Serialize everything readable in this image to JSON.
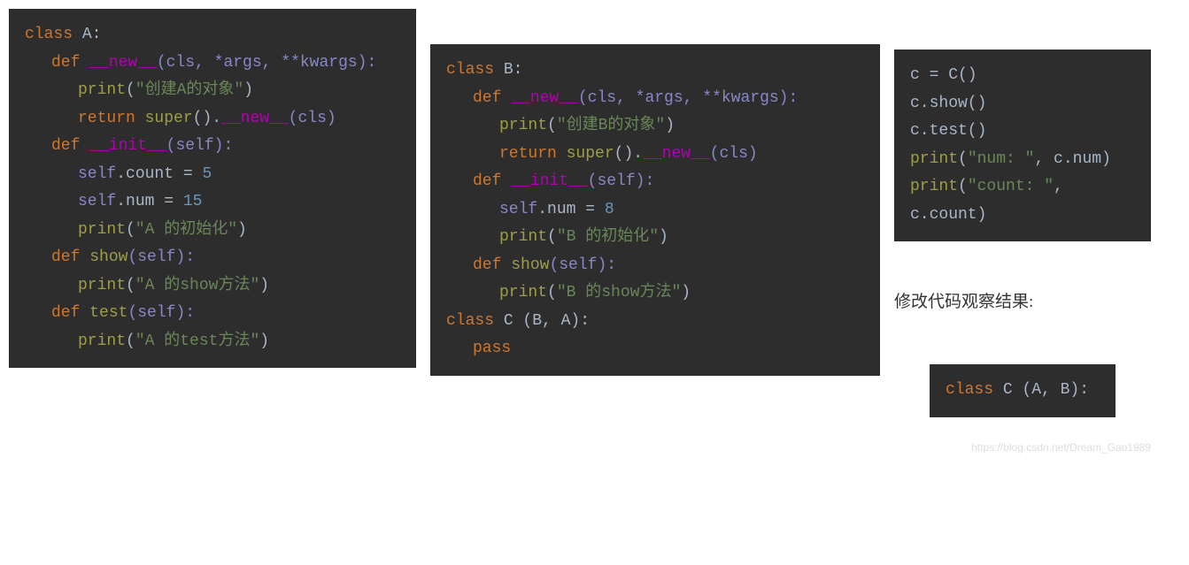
{
  "block1": {
    "l1": {
      "kw": "class ",
      "name": "A:"
    },
    "l2": {
      "kw": "def ",
      "fn": "__new__",
      "p": "(cls, *args, **kwargs):"
    },
    "l3": {
      "fn": "print",
      "open": "(",
      "s": "\"创建A的对象\"",
      "close": ")"
    },
    "l4": {
      "kw": "return ",
      "call": "super",
      "p1": "().",
      "fn": "__new__",
      "p2": "(cls)"
    },
    "l5": {
      "kw": "def ",
      "fn": "__init__",
      "p": "(self):"
    },
    "l6": {
      "a": "self",
      "b": ".count = ",
      "n": "5"
    },
    "l7": {
      "a": "self",
      "b": ".num = ",
      "n": "15"
    },
    "l8": {
      "fn": "print",
      "open": "(",
      "s": "\"A 的初始化\"",
      "close": ")"
    },
    "l9": {
      "kw": "def ",
      "fn": "show",
      "p": "(self):"
    },
    "l10": {
      "fn": "print",
      "open": "(",
      "s": "\"A 的show方法\"",
      "close": ")"
    },
    "l11": {
      "kw": "def ",
      "fn": "test",
      "p": "(self):"
    },
    "l12": {
      "fn": "print",
      "open": "(",
      "s": "\"A 的test方法\"",
      "close": ")"
    }
  },
  "block2": {
    "l1": {
      "kw": "class ",
      "name": "B:"
    },
    "l2": {
      "kw": "def ",
      "fn": "__new__",
      "p": "(cls, *args, **kwargs):"
    },
    "l3": {
      "fn": "print",
      "open": "(",
      "s": "\"创建B的对象\"",
      "close": ")"
    },
    "l4": {
      "kw": "return ",
      "call": "super",
      "p1": "().",
      "fn": "__new__",
      "p2": "(cls)"
    },
    "l5": {
      "kw": "def ",
      "fn": "__init__",
      "p": "(self):"
    },
    "l6": {
      "a": "self",
      "b": ".num = ",
      "n": "8"
    },
    "l7": {
      "fn": "print",
      "open": "(",
      "s": "\"B 的初始化\"",
      "close": ")"
    },
    "l8": {
      "kw": "def ",
      "fn": "show",
      "p": "(self):"
    },
    "l9": {
      "fn": "print",
      "open": "(",
      "s": "\"B 的show方法\"",
      "close": ")"
    },
    "l10": {
      "kw": "class ",
      "name": "C (B, A):"
    },
    "l11": {
      "kw": "pass"
    }
  },
  "block3": {
    "l1": {
      "a": "c = C()"
    },
    "l2": {
      "a": "c.show()"
    },
    "l3": {
      "a": "c.test()"
    },
    "l4": {
      "fn": "print",
      "open": "(",
      "s": "\"num: \"",
      "rest": ", c.num)"
    },
    "l5": {
      "fn": "print",
      "open": "(",
      "s": "\"count: \"",
      "rest": ", "
    },
    "l6": {
      "a": "c.count)"
    }
  },
  "caption": "修改代码观察结果:",
  "block4": {
    "l1": {
      "kw": "class ",
      "name": "C (A, B):"
    }
  },
  "watermark": "https://blog.csdn.net/Dream_Gao1989"
}
